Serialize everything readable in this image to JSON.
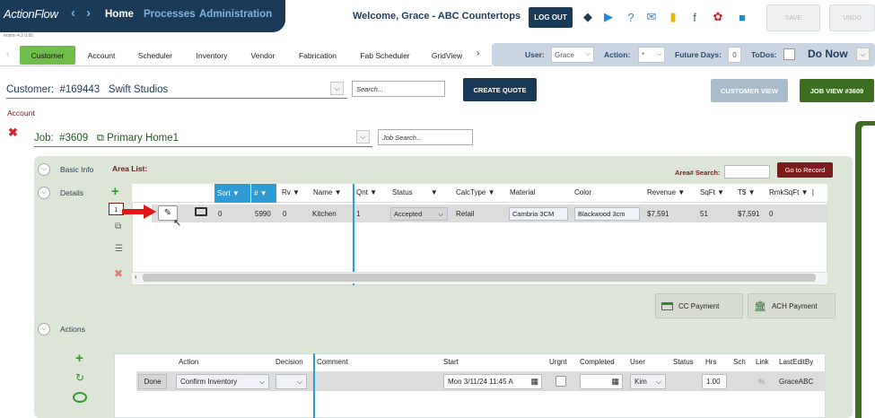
{
  "app": {
    "logo": "ActionFlow",
    "version": "ersion 4.2.0.95"
  },
  "nav": {
    "items": [
      "Home",
      "Processes",
      "Administration"
    ]
  },
  "header": {
    "welcome": "Welcome, Grace - ABC Countertops",
    "logout": "LOG OUT",
    "save": "SAVE",
    "undo": "UNDO"
  },
  "tabs": [
    "Customer",
    "Account",
    "Scheduler",
    "Inventory",
    "Vendor",
    "Fabrication",
    "Fab Scheduler",
    "GridView"
  ],
  "filters": {
    "user_label": "User:",
    "user_value": "Grace",
    "action_label": "Action:",
    "action_value": "*",
    "future_label": "Future Days:",
    "future_value": "0",
    "todos_label": "ToDos:",
    "donow": "Do Now"
  },
  "customer": {
    "label": "Customer:",
    "number": "#169443",
    "name": "Swift Studios",
    "search_placeholder": "Search..."
  },
  "buttons": {
    "create_quote": "CREATE QUOTE",
    "customer_view": "CUSTOMER VIEW",
    "job_view": "JOB VIEW #3609",
    "goto_record": "Go to Record",
    "cc_payment": "CC Payment",
    "ach_payment": "ACH Payment"
  },
  "account_label": "Account",
  "job": {
    "label": "Job:",
    "number": "#3609",
    "name": "Primary Home1",
    "search_placeholder": "Job Search..."
  },
  "sections": {
    "basic_info": "Basic Info",
    "details": "Details",
    "actions": "Actions"
  },
  "area_list": {
    "title": "Area List:",
    "search_label": "Area# Search:",
    "row_number": "1",
    "columns": [
      "Sort",
      "#",
      "Rv",
      "Name",
      "Qnt",
      "Status",
      "CalcType",
      "Material",
      "Color",
      "Revenue",
      "SqFt",
      "T$",
      "RmkSqFt"
    ],
    "row": {
      "sort": "0",
      "num": "5990",
      "rv": "0",
      "name": "Kitchen",
      "qnt": "1",
      "status": "Accepted",
      "calctype": "Retail",
      "material": "Cambria 3CM",
      "color": "Blackwood 3cm",
      "revenue": "$7,591",
      "sqft": "51",
      "tdollar": "$7,591",
      "rmksqft": "0"
    }
  },
  "actions_grid": {
    "columns": [
      "Action",
      "Decision",
      "Comment",
      "Start",
      "Urgnt",
      "Completed",
      "User",
      "Status",
      "Hrs",
      "Sch",
      "Link",
      "LastEditBy"
    ],
    "row": {
      "done": "Done",
      "action": "Confirm Inventory",
      "start": "Mon 3/11/24 11:45 A",
      "user": "Kim",
      "hrs": "1.00",
      "link": "%",
      "lasteditby": "GraceABC"
    }
  }
}
